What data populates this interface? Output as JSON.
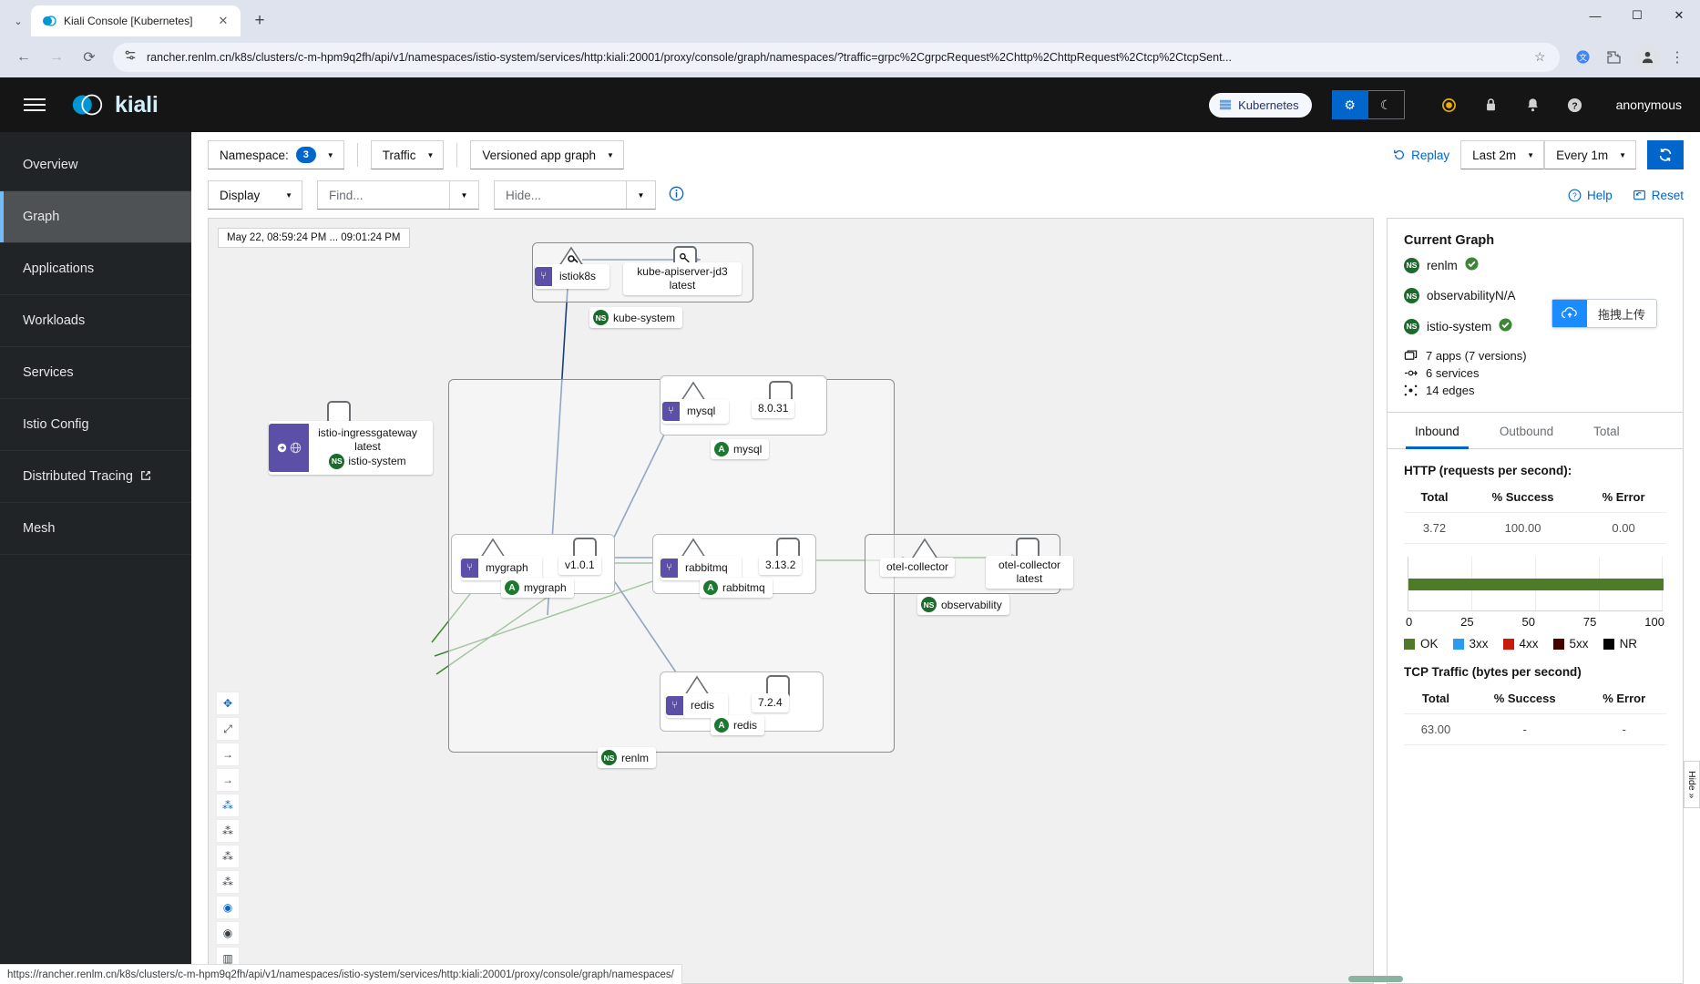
{
  "browser": {
    "tab_title": "Kiali Console [Kubernetes]",
    "new_tab_label": "+",
    "close_tab_label": "✕",
    "minimize_label": "—",
    "maximize_label": "☐",
    "close_label": "✕",
    "back_label": "←",
    "forward_label": "→",
    "reload_label": "⟳",
    "url": "rancher.renlm.cn/k8s/clusters/c-m-hpm9q2fh/api/v1/namespaces/istio-system/services/http:kiali:20001/proxy/console/graph/namespaces/?traffic=grpc%2CgrpcRequest%2Chttp%2ChttpRequest%2Ctcp%2CtcpSent...",
    "star_label": "☆",
    "status_url": "https://rancher.renlm.cn/k8s/clusters/c-m-hpm9q2fh/api/v1/namespaces/istio-system/services/http:kiali:20001/proxy/console/graph/namespaces/"
  },
  "header": {
    "logo_text": "kiali",
    "cluster_chip": "Kubernetes",
    "theme_light_icon": "gear-icon",
    "theme_dark_icon": "moon-icon",
    "icons": [
      "record-icon",
      "lock-icon",
      "bell-icon",
      "help-icon"
    ],
    "user": "anonymous"
  },
  "sidebar": {
    "items": [
      {
        "label": "Overview",
        "active": false,
        "external": false
      },
      {
        "label": "Graph",
        "active": true,
        "external": false
      },
      {
        "label": "Applications",
        "active": false,
        "external": false
      },
      {
        "label": "Workloads",
        "active": false,
        "external": false
      },
      {
        "label": "Services",
        "active": false,
        "external": false
      },
      {
        "label": "Istio Config",
        "active": false,
        "external": false
      },
      {
        "label": "Distributed Tracing",
        "active": false,
        "external": true
      },
      {
        "label": "Mesh",
        "active": false,
        "external": false
      }
    ]
  },
  "toolbar": {
    "namespace_label": "Namespace:",
    "namespace_count": "3",
    "traffic_label": "Traffic",
    "graph_type": "Versioned app graph",
    "replay_label": "Replay",
    "duration": "Last 2m",
    "refresh_interval": "Every 1m",
    "refresh_icon": "refresh-icon",
    "display_label": "Display",
    "find_placeholder": "Find...",
    "hide_placeholder": "Hide...",
    "help_label": "Help",
    "reset_label": "Reset"
  },
  "graph": {
    "time_range": "May 22, 08:59:24 PM ... 09:01:24 PM",
    "left_tools": [
      "drag-pan-icon",
      "fit-screen-icon",
      "arrow-right-icon",
      "arrow-right-alt-icon",
      "layout-dagre-icon",
      "layout-grid-icon",
      "layout-cola-icon",
      "layout-concentric-icon",
      "namespace-box-icon",
      "namespace-box-alt-icon",
      "legend-icon"
    ],
    "namespaces": [
      {
        "name": "kube-system",
        "chip": "NS"
      },
      {
        "name": "renlm",
        "chip": "NS"
      },
      {
        "name": "observability",
        "chip": "NS"
      }
    ],
    "nodes": [
      {
        "id": "istiok8s",
        "label": "istiok8s",
        "badge": "workload-icon",
        "shape": "triangle"
      },
      {
        "id": "kube-apiserver",
        "label": "kube-apiserver-jd3",
        "sublabel": "latest",
        "shape": "rounded-square"
      },
      {
        "id": "istio-ingressgateway",
        "label": "istio-ingressgateway",
        "sublabel": "latest",
        "namespace": "istio-system",
        "shape": "rounded-square"
      },
      {
        "id": "mysql-app",
        "label": "mysql",
        "version": "8.0.31",
        "app": "mysql"
      },
      {
        "id": "mygraph-app",
        "label": "mygraph",
        "version": "v1.0.1",
        "app": "mygraph"
      },
      {
        "id": "rabbitmq-app",
        "label": "rabbitmq",
        "version": "3.13.2",
        "app": "rabbitmq"
      },
      {
        "id": "redis-app",
        "label": "redis",
        "version": "7.2.4",
        "app": "redis"
      },
      {
        "id": "otel-collector",
        "label": "otel-collector",
        "sublabel": "latest",
        "namespace": "observability"
      }
    ]
  },
  "side_panel": {
    "title": "Current Graph",
    "namespaces": [
      {
        "chip": "NS",
        "name": "renlm",
        "status": "ok"
      },
      {
        "chip": "NS",
        "name": "observabilityN/A",
        "status": "none"
      },
      {
        "chip": "NS",
        "name": "istio-system",
        "status": "ok"
      }
    ],
    "stats": [
      {
        "icon": "apps-icon",
        "text": "7 apps (7 versions)"
      },
      {
        "icon": "services-icon",
        "text": "6 services"
      },
      {
        "icon": "edges-icon",
        "text": "14 edges"
      }
    ],
    "tabs": [
      {
        "label": "Inbound",
        "active": true
      },
      {
        "label": "Outbound",
        "active": false
      },
      {
        "label": "Total",
        "active": false
      }
    ],
    "http_section_title": "HTTP (requests per second):",
    "http_table": {
      "headers": [
        "Total",
        "% Success",
        "% Error"
      ],
      "rows": [
        [
          "3.72",
          "100.00",
          "0.00"
        ]
      ]
    },
    "tcp_section_title": "TCP Traffic (bytes per second)",
    "tcp_table": {
      "headers": [
        "Total",
        "% Success",
        "% Error"
      ],
      "rows": [
        [
          "63.00",
          "-",
          "-"
        ]
      ]
    },
    "hide_label": "Hide »"
  },
  "upload_widget": {
    "icon": "cloud-upload-icon",
    "label": "拖拽上传"
  },
  "chart_data": {
    "type": "bar",
    "title": "HTTP status distribution",
    "categories": [
      "OK"
    ],
    "series": [
      {
        "name": "OK",
        "values": [
          100
        ],
        "color": "#4f7a28"
      },
      {
        "name": "3xx",
        "values": [
          0
        ],
        "color": "#2b9af3"
      },
      {
        "name": "4xx",
        "values": [
          0
        ],
        "color": "#c9190b"
      },
      {
        "name": "5xx",
        "values": [
          0
        ],
        "color": "#470000"
      },
      {
        "name": "NR",
        "values": [
          0
        ],
        "color": "#030303"
      }
    ],
    "xlabel": "",
    "ylabel": "",
    "xlim": [
      0,
      100
    ],
    "x_ticks": [
      "0",
      "25",
      "50",
      "75",
      "100"
    ],
    "legend": [
      "OK",
      "3xx",
      "4xx",
      "5xx",
      "NR"
    ],
    "legend_position": "bottom",
    "grid": true
  }
}
